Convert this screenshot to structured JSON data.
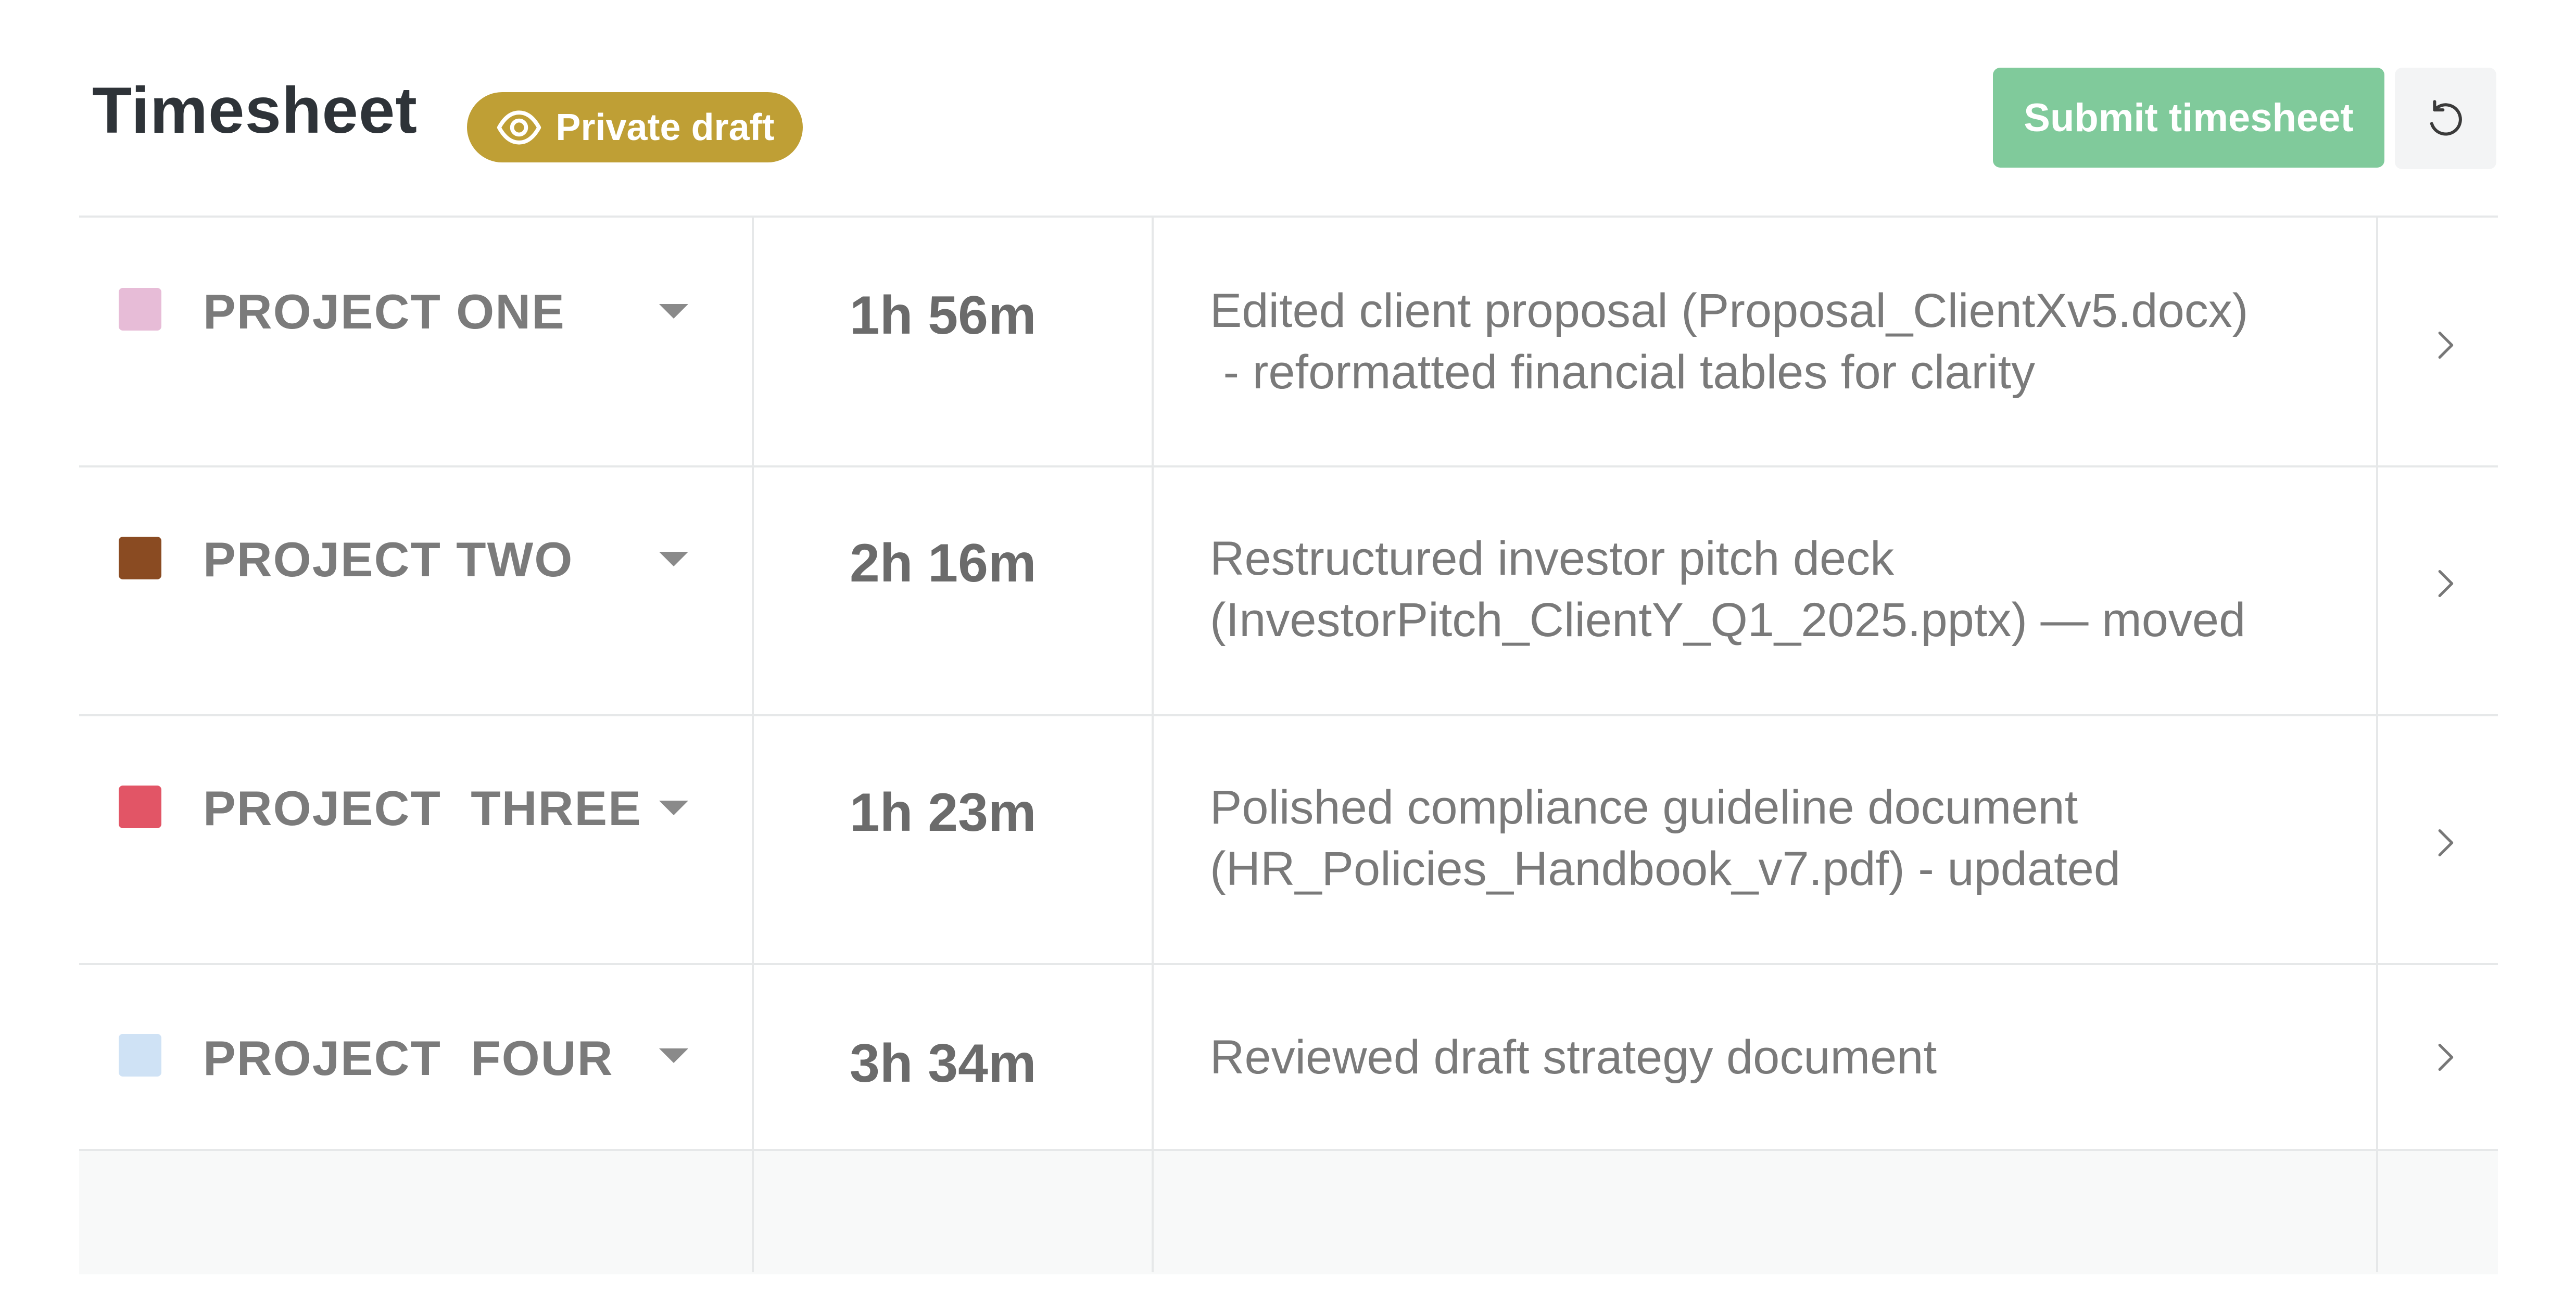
{
  "header": {
    "title": "Timesheet",
    "badge_label": "Private draft",
    "badge_icon": "eye-icon",
    "submit_label": "Submit timesheet",
    "reset_icon": "undo-icon"
  },
  "colors": {
    "badge": "#bf9f35",
    "submit": "#80ca9b",
    "reset_bg": "#f3f4f5"
  },
  "entries": [
    {
      "project": "PROJECT ONE",
      "color": "#e7bcd7",
      "duration": "1h 56m",
      "description": "Edited client proposal (Proposal_ClientXv5.docx)\n - reformatted financial tables for clarity"
    },
    {
      "project": "PROJECT TWO",
      "color": "#8a4b22",
      "duration": "2h 16m",
      "description": "Restructured investor pitch deck\n(InvestorPitch_ClientY_Q1_2025.pptx) — moved"
    },
    {
      "project": "PROJECT  THREE",
      "color": "#e25566",
      "duration": "1h 23m",
      "description": "Polished compliance guideline document\n(HR_Policies_Handbook_v7.pdf) - updated"
    },
    {
      "project": "PROJECT  FOUR",
      "color": "#cfe2f5",
      "duration": "3h 34m",
      "description": "Reviewed draft strategy document"
    }
  ]
}
